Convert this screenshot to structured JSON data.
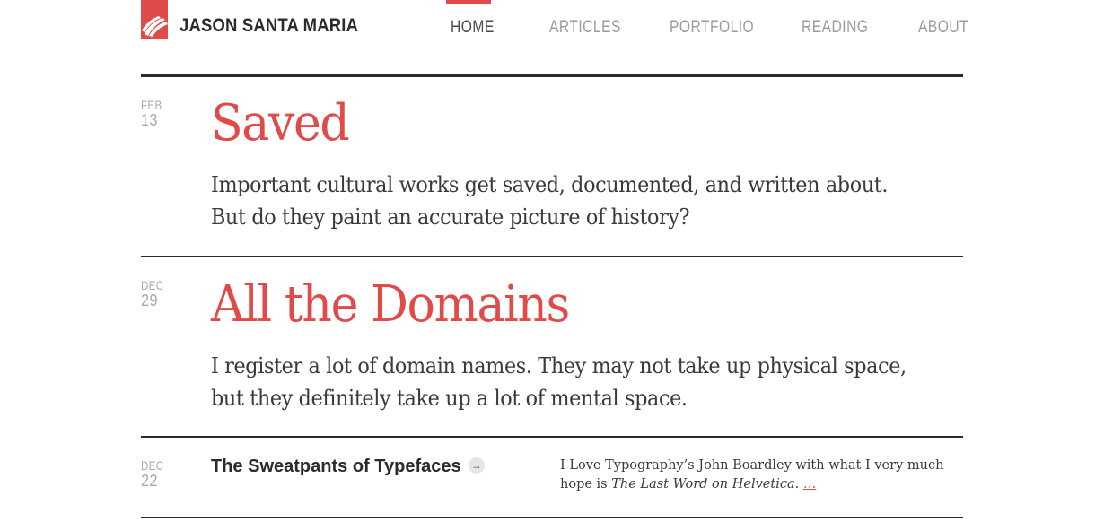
{
  "site": {
    "title": "JASON SANTA MARIA",
    "accent_color": "#e04b4a",
    "logo_icon": "stripes-logo-icon"
  },
  "nav": {
    "items": [
      {
        "label": "HOME",
        "active": true
      },
      {
        "label": "ARTICLES",
        "active": false
      },
      {
        "label": "PORTFOLIO",
        "active": false
      },
      {
        "label": "READING",
        "active": false
      },
      {
        "label": "ABOUT",
        "active": false
      }
    ]
  },
  "posts": [
    {
      "month": "FEB",
      "day": "13",
      "title": "Saved",
      "excerpt_line1": "Important cultural works get saved, documented, and written about.",
      "excerpt_line2": "But do they paint an accurate picture of history?"
    },
    {
      "month": "DEC",
      "day": "29",
      "title": "All the Domains",
      "excerpt_line1": "I register a lot of domain names. They may not take up physical space,",
      "excerpt_line2": "but they definitely take up a lot of mental space."
    }
  ],
  "link_post": {
    "month": "DEC",
    "day": "22",
    "title": "The Sweatpants of Typefaces",
    "arrow_icon": "arrow-right-icon",
    "excerpt_prefix": "I Love Typography’s John Boardley with what I very much hope is",
    "excerpt_italic": "The Last Word on Helvetica",
    "excerpt_suffix": ".",
    "more_label": "…"
  }
}
